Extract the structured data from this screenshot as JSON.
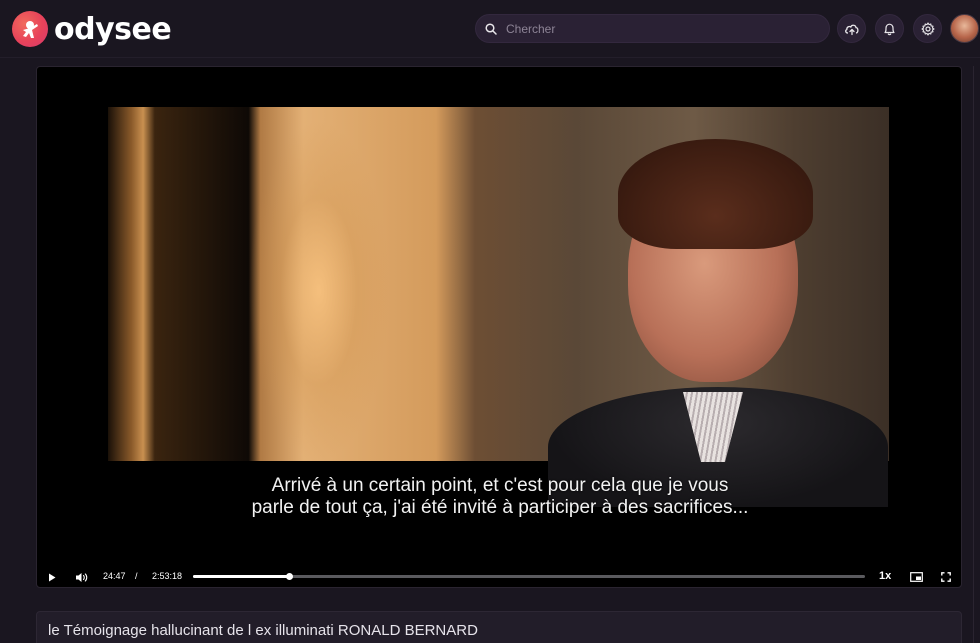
{
  "header": {
    "logo_text": "odysee",
    "search": {
      "placeholder": "Chercher",
      "value": ""
    },
    "icons": [
      "upload-icon",
      "bell-icon",
      "gear-icon"
    ],
    "accent_color": "#e8425a"
  },
  "player": {
    "subtitle_line1": "Arrivé à un certain point, et c'est pour cela que je vous",
    "subtitle_line2": "parle de tout ça, j'ai été invité à participer à des sacrifices...",
    "current_time": "24:47",
    "separator": "/",
    "duration": "2:53:18",
    "progress_fraction": 0.143,
    "playback_rate": "1x"
  },
  "video": {
    "title": "le Témoignage hallucinant de l ex illuminati RONALD BERNARD"
  }
}
